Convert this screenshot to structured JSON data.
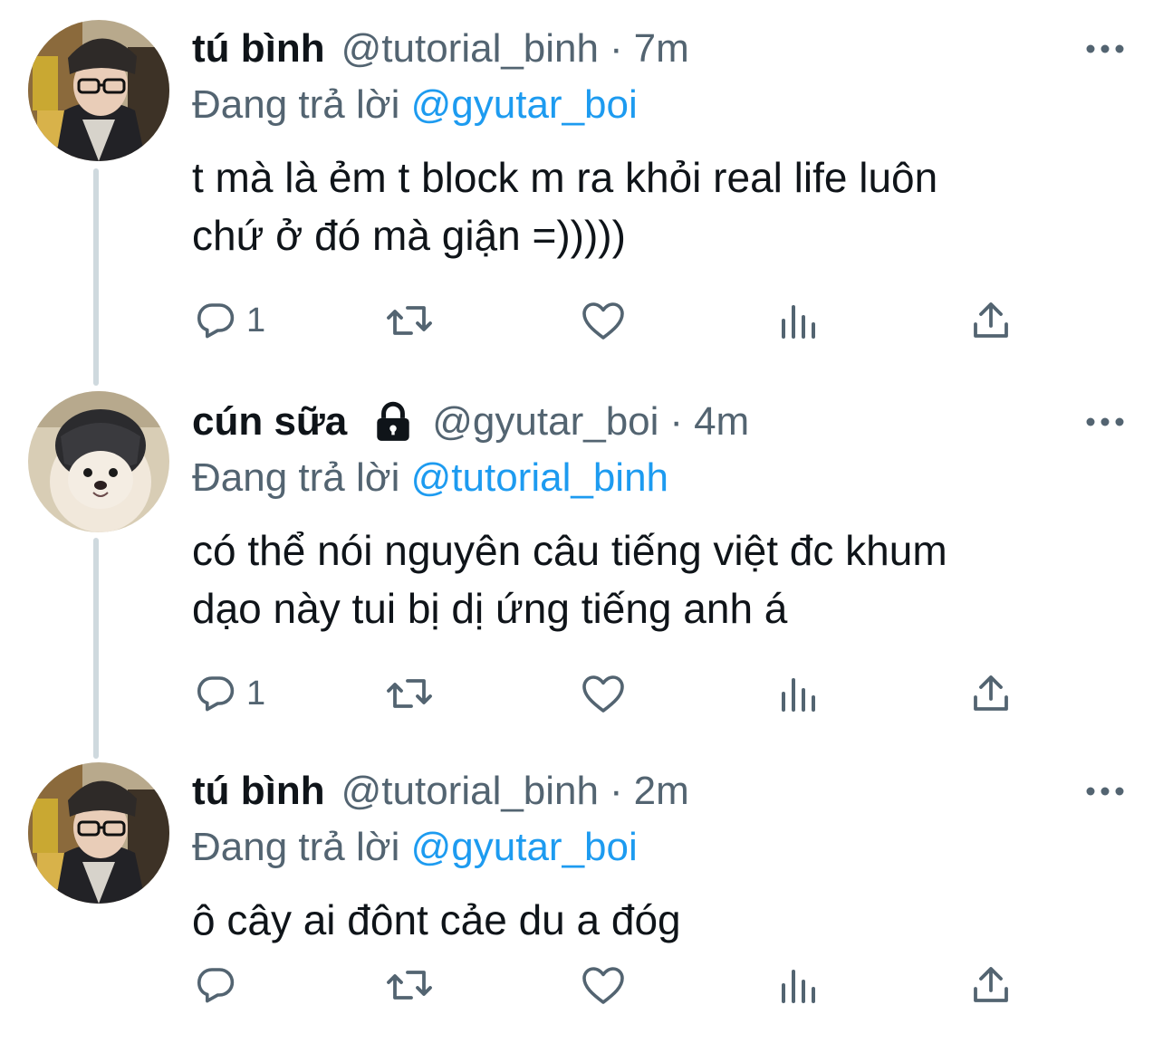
{
  "tweets": [
    {
      "display_name": "tú bình",
      "handle": "@tutorial_binh",
      "separator": "·",
      "time": "7m",
      "protected": false,
      "reply_prefix": "Đang trả lời",
      "reply_to": "@gyutar_boi",
      "text": "t mà là ẻm t block m ra khỏi real life luôn\nchứ ở đó mà giận =)))))",
      "reply_count": "1",
      "retweet_count": "",
      "like_count": ""
    },
    {
      "display_name": "cún sữa",
      "handle": "@gyutar_boi",
      "separator": "·",
      "time": "4m",
      "protected": true,
      "reply_prefix": "Đang trả lời",
      "reply_to": "@tutorial_binh",
      "text": "có thể nói nguyên câu tiếng việt đc khum\ndạo này tui bị dị ứng tiếng anh á",
      "reply_count": "1",
      "retweet_count": "",
      "like_count": ""
    },
    {
      "display_name": "tú bình",
      "handle": "@tutorial_binh",
      "separator": "·",
      "time": "2m",
      "protected": false,
      "reply_prefix": "Đang trả lời",
      "reply_to": "@gyutar_boi",
      "text": "ô cây ai đônt cảe du a đóg",
      "reply_count": "",
      "retweet_count": "",
      "like_count": ""
    }
  ],
  "icons": {
    "reply": "reply-icon",
    "retweet": "retweet-icon",
    "like": "like-icon",
    "analytics": "analytics-icon",
    "share": "share-icon",
    "more": "more-icon",
    "lock": "lock-icon"
  },
  "colors": {
    "text": "#0f1419",
    "secondary": "#536471",
    "accent": "#1d9bf0",
    "thread_line": "#cfd9de"
  }
}
